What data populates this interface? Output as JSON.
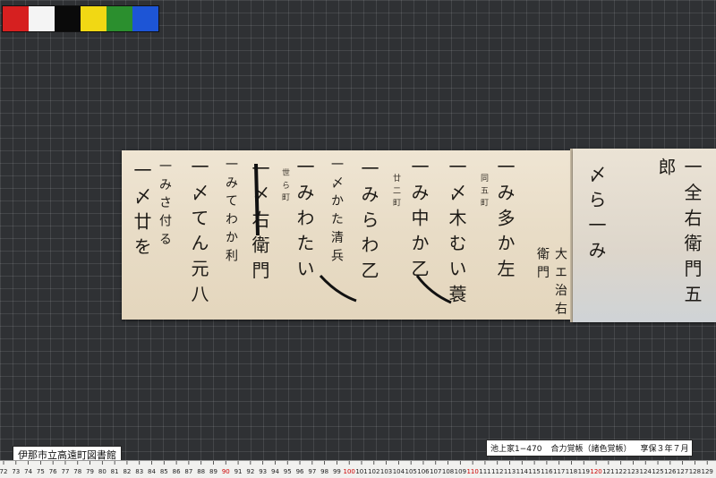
{
  "library_label": "伊那市立高遠町図書館",
  "document_label": {
    "id": "池上家1−470",
    "title": "合力覚帳（諸色覚帳）",
    "date": "享保３年７月"
  },
  "color_chart": [
    "#d62020",
    "#f4f4f4",
    "#0a0a0a",
    "#f1d814",
    "#2b8f2e",
    "#1d55d6"
  ],
  "ruler": {
    "start": 72,
    "end": 129
  },
  "manuscript_columns": [
    "一 〆 廿 を",
    "一 み さ 付 る",
    "一 〆 て ん 元 八",
    "一 み て わ か 利",
    "一 〆 右 衛 門",
    "一 み わ た い",
    "一 〆 か た 清 兵",
    "一 み ら わ 乙",
    "一 み 中 か 乙",
    "一 〆 木 む い 蓑",
    "一 み 多 か 左",
    "大 エ 治 右 衛 門",
    "〆 ら 一 み",
    "一 全 右 衛 門 五 郎"
  ],
  "annotations": [
    "世 ら 町",
    "廿 二 町",
    "同 五 町"
  ]
}
